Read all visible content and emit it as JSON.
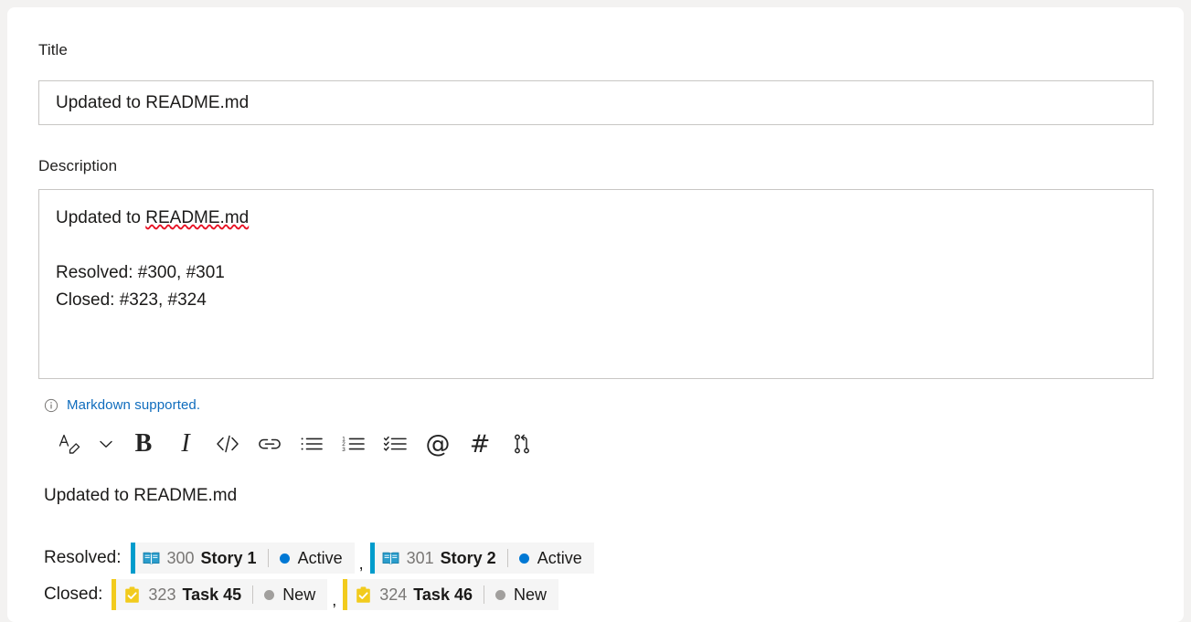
{
  "form": {
    "title_label": "Title",
    "title_value": "Updated to README.md",
    "description_label": "Description",
    "description_lines": [
      "Updated to README.md",
      "",
      "Resolved: #300, #301",
      "Closed: #323, #324"
    ],
    "description_text_prefix": "Updated to ",
    "description_spellchecked_word": "README.md",
    "description_line_resolved": "Resolved: #300, #301",
    "description_line_closed": "Closed: #323, #324"
  },
  "markdown_hint": {
    "icon": "info-circle-icon",
    "text": "Markdown supported."
  },
  "toolbar": {
    "items": [
      {
        "name": "font-style-icon",
        "label": "A",
        "type": "svg"
      },
      {
        "name": "chevron-down-icon",
        "label": "",
        "type": "svg"
      },
      {
        "name": "bold-button",
        "label": "B",
        "type": "text"
      },
      {
        "name": "italic-button",
        "label": "I",
        "type": "text"
      },
      {
        "name": "code-button",
        "label": "</>",
        "type": "svg"
      },
      {
        "name": "link-button",
        "label": "",
        "type": "svg"
      },
      {
        "name": "bulleted-list-button",
        "label": "",
        "type": "svg"
      },
      {
        "name": "numbered-list-button",
        "label": "",
        "type": "svg"
      },
      {
        "name": "checklist-button",
        "label": "",
        "type": "svg"
      },
      {
        "name": "mention-button",
        "label": "@",
        "type": "text"
      },
      {
        "name": "hashtag-button",
        "label": "#",
        "type": "text"
      },
      {
        "name": "pull-request-button",
        "label": "",
        "type": "svg"
      }
    ]
  },
  "preview": {
    "heading": "Updated to README.md",
    "rows": [
      {
        "label": "Resolved:",
        "chips": [
          {
            "type": "story",
            "icon": "user-story-book-icon",
            "id": "300",
            "title": "Story 1",
            "state": "Active",
            "state_color": "#0078d4",
            "accent_color": "#009ccc"
          },
          {
            "type": "story",
            "icon": "user-story-book-icon",
            "id": "301",
            "title": "Story 2",
            "state": "Active",
            "state_color": "#0078d4",
            "accent_color": "#009ccc"
          }
        ],
        "separator": ","
      },
      {
        "label": "Closed:",
        "chips": [
          {
            "type": "task",
            "icon": "task-clipboard-check-icon",
            "id": "323",
            "title": "Task 45",
            "state": "New",
            "state_color": "#a19f9d",
            "accent_color": "#f2cb1d"
          },
          {
            "type": "task",
            "icon": "task-clipboard-check-icon",
            "id": "324",
            "title": "Task 46",
            "state": "New",
            "state_color": "#a19f9d",
            "accent_color": "#f2cb1d"
          }
        ],
        "separator": ","
      }
    ]
  },
  "colors": {
    "link": "#0f6cbd",
    "story_accent": "#009ccc",
    "task_accent": "#f2cb1d",
    "chip_background": "#f5f5f5",
    "panel_background": "#ffffff",
    "page_background": "#f3f2f1"
  }
}
